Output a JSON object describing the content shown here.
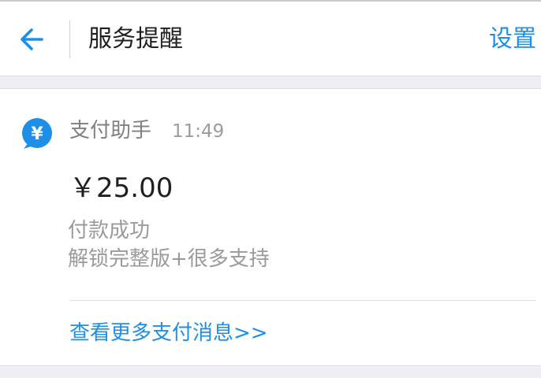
{
  "header": {
    "title": "服务提醒",
    "settings_label": "设置",
    "back_icon": "arrow-left-icon"
  },
  "message": {
    "avatar_icon": "yuan-icon",
    "avatar_glyph": "¥",
    "sender": "支付助手",
    "time": "11:49",
    "amount": "￥25.00",
    "status": "付款成功",
    "detail": "解锁完整版+很多支持",
    "more_link": "查看更多支付消息>>"
  },
  "colors": {
    "accent": "#1e8fe8",
    "background": "#efeff3"
  }
}
